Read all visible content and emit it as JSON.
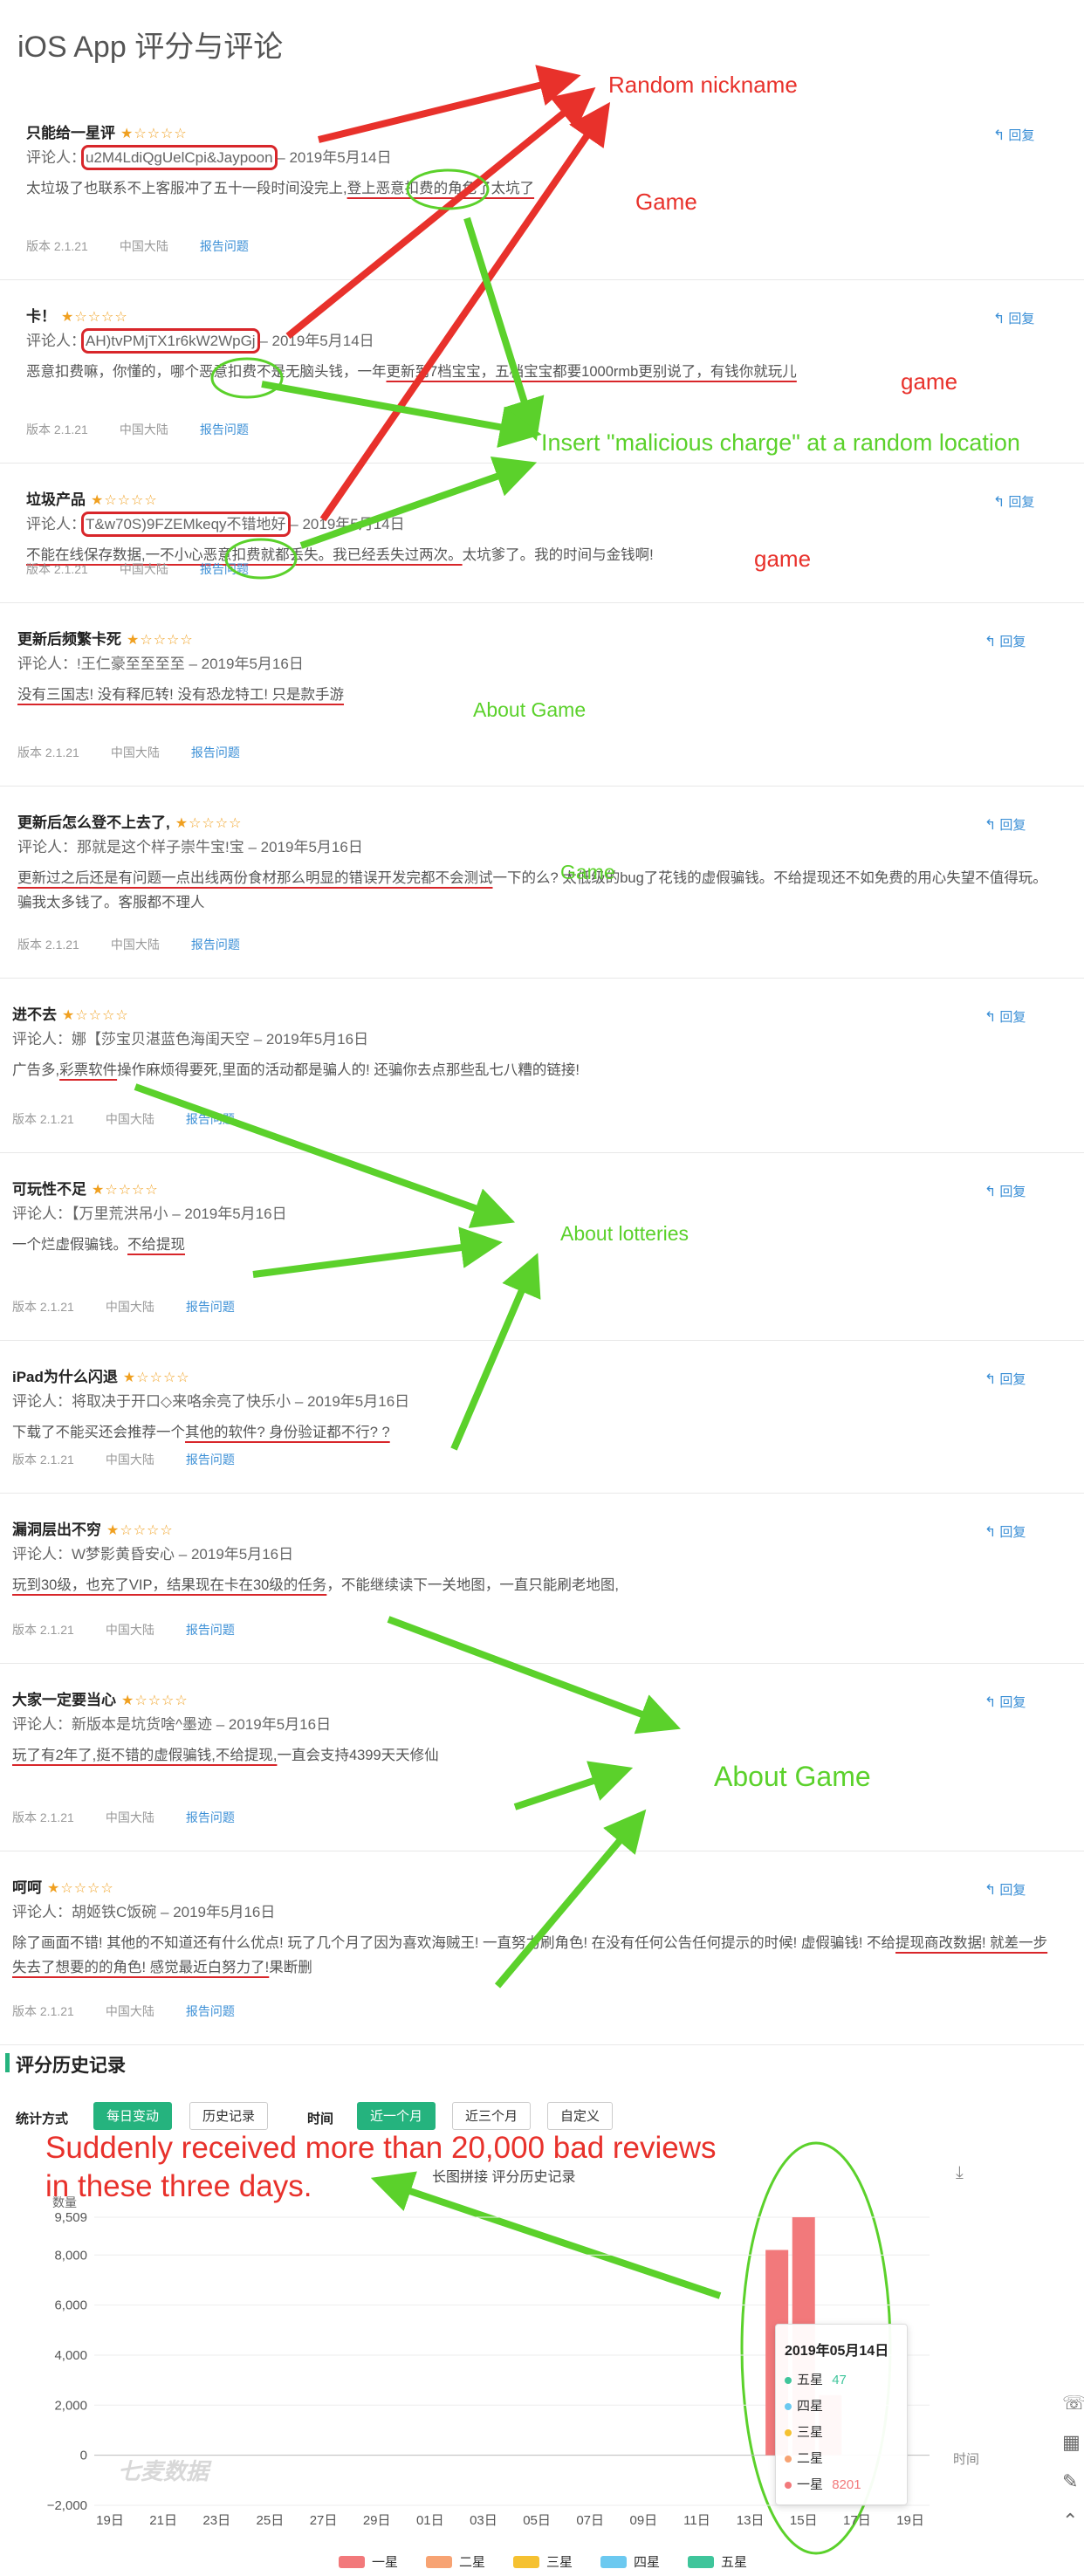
{
  "page_title": "iOS App 评分与评论",
  "reply_label": "回复",
  "report_label": "报告问题",
  "reviews": [
    {
      "title": "只能给一星评",
      "stars": "★☆☆☆☆",
      "meta_prefix": "评论人：",
      "author": "u2M4LdiQgUelCpi&Jaypoon",
      "meta_date": "– 2019年5月14日",
      "body_a": "太垃圾了也联系不上客服冲了五十一段时间没完上,",
      "body_b": "登上恶意扣费的角色了太坑了",
      "body_c": "",
      "version": "版本 2.1.21",
      "region": "中国大陆"
    },
    {
      "title": "卡！",
      "stars": "★☆☆☆☆",
      "meta_prefix": "评论人：",
      "author": "AH)tvPMjTX1r6kW2WpGj",
      "meta_date": "– 2019年5月14日",
      "body_a": "恶意扣费嘛，你懂的，哪个恶意扣费不是无脑头钱，一年",
      "body_b": "更新到7档宝宝，五档宝宝都要1000rmb更别说了，有钱你就玩儿",
      "body_c": "",
      "version": "版本 2.1.21",
      "region": "中国大陆"
    },
    {
      "title": "垃圾产品",
      "stars": "★☆☆☆☆",
      "meta_prefix": "评论人：",
      "author": "T&w70S)9FZEMkeqy不错地好",
      "meta_date": "– 2019年5月14日",
      "body_a": "",
      "body_b": "不能在线保存数据,一不小心恶意扣费就都丢失。我已经丢失过两次。",
      "body_c": "太坑爹了。我的时间与金钱啊!",
      "version": "版本 2.1.21",
      "region": "中国大陆"
    },
    {
      "title": "更新后频繁卡死",
      "stars": "★☆☆☆☆",
      "meta_prefix": "评论人：",
      "author": "!王仁豪至至至至",
      "meta_date": "– 2019年5月16日",
      "body_a": "",
      "body_b": "没有三国志! 没有释厄转! 没有恐龙特工! 只是款手游",
      "body_c": "",
      "version": "版本 2.1.21",
      "region": "中国大陆"
    },
    {
      "title": "更新后怎么登不上去了,",
      "stars": "★☆☆☆☆",
      "meta_prefix": "评论人：",
      "author": "那就是这个样子崇牛宝!宝",
      "meta_date": "– 2019年5月16日",
      "body_a": "",
      "body_b": "更新过之后还是有问题一点出线两份食材那么明显的错误开发完都不会测试",
      "body_c": "一下的么? 太低级的bug了花钱的虚假骗钱。不给提现还不如免费的用心失望不值得玩。骗我太多钱了。客服都不理人",
      "version": "版本 2.1.21",
      "region": "中国大陆"
    },
    {
      "title": "进不去",
      "stars": "★☆☆☆☆",
      "meta_prefix": "评论人：",
      "author": "娜【莎宝贝湛蓝色海闺天空",
      "meta_date": "– 2019年5月16日",
      "body_a": "广告多,",
      "body_b": "彩票软件",
      "body_c": "操作麻烦得要死,里面的活动都是骗人的! 还骗你去点那些乱七八糟的链接!",
      "version": "版本 2.1.21",
      "region": "中国大陆"
    },
    {
      "title": "可玩性不足",
      "stars": "★☆☆☆☆",
      "meta_prefix": "评论人：",
      "author": "【万里荒洪吊小",
      "meta_date": "– 2019年5月16日",
      "body_a": "一个烂虚假骗钱。",
      "body_b": "不给提现",
      "body_c": "",
      "version": "版本 2.1.21",
      "region": "中国大陆"
    },
    {
      "title": "iPad为什么闪退",
      "stars": "★☆☆☆☆",
      "meta_prefix": "评论人：",
      "author": "将取决于开口◇来咯余亮了快乐小",
      "meta_date": "– 2019年5月16日",
      "body_a": "下载了不能买还会推荐一个",
      "body_b": "其他的软件? 身份验证都不行? ?",
      "body_c": "",
      "version": "版本 2.1.21",
      "region": "中国大陆"
    },
    {
      "title": "漏洞层出不穷",
      "stars": "★☆☆☆☆",
      "meta_prefix": "评论人：",
      "author": "W梦影黄昏安心",
      "meta_date": "– 2019年5月16日",
      "body_a": "",
      "body_b": "玩到30级，也充了VIP，结果现在卡在30级的任务",
      "body_c": "，不能继续读下一关地图，一直只能刷老地图,",
      "version": "版本 2.1.21",
      "region": "中国大陆"
    },
    {
      "title": "大家一定要当心",
      "stars": "★☆☆☆☆",
      "meta_prefix": "评论人：",
      "author": "新版本是坑货啥^墨迹",
      "meta_date": "– 2019年5月16日",
      "body_a": "",
      "body_b": "玩了有2年了,挺不错的虚假骗钱,不给提现,",
      "body_c": "一直会支持4399天天修仙",
      "version": "版本 2.1.21",
      "region": "中国大陆"
    },
    {
      "title": "呵呵",
      "stars": "★☆☆☆☆",
      "meta_prefix": "评论人：",
      "author": "胡姬铁C饭碗",
      "meta_date": "– 2019年5月16日",
      "body_a": "除了画面不错! 其他的不知道还有什么优点! 玩了几个月了因为喜欢海贼王! 一直努力刷角色! 在没有任何公告任何提示的时候! 虚假骗钱! 不给",
      "body_b": "提现商改数据! 就差一步失去了想要的的角色! 感觉最近白努力了!",
      "body_c": "果断删",
      "version": "版本 2.1.21",
      "region": "中国大陆"
    }
  ],
  "annotations": {
    "random_nickname": "Random nickname",
    "game1": "Game",
    "game2": "game",
    "game3": "game",
    "insert_charge": "Insert \"malicious charge\" at a random location",
    "about_game_small": "About Game",
    "game_green": "Game",
    "about_lotteries": "About lotteries",
    "about_game_big": "About Game",
    "bad_reviews_l1": "Suddenly received more than 20,000 bad reviews",
    "bad_reviews_l2": "in these three days."
  },
  "history": {
    "section_title": "评分历史记录",
    "stat_label": "统计方式",
    "btn_daily": "每日变动",
    "btn_history": "历史记录",
    "time_label": "时间",
    "btn_1m": "近一个月",
    "btn_3m": "近三个月",
    "btn_custom": "自定义",
    "chart_subtitle": "长图拼接 评分历史记录",
    "watermark": "七麦数据",
    "x_axis_label": "时间",
    "y_axis_label": "数量"
  },
  "tooltip": {
    "date": "2019年05月14日",
    "rows": [
      {
        "label": "五星",
        "value": "47",
        "color": "#3fc59b"
      },
      {
        "label": "四星",
        "value": "",
        "color": "#6cc9f0"
      },
      {
        "label": "三星",
        "value": "",
        "color": "#f5c131"
      },
      {
        "label": "二星",
        "value": "",
        "color": "#f7a373"
      },
      {
        "label": "一星",
        "value": "8201",
        "color": "#f2797b"
      }
    ]
  },
  "chart_data": {
    "type": "bar",
    "x_ticks": [
      "19日",
      "21日",
      "23日",
      "25日",
      "27日",
      "29日",
      "01日",
      "03日",
      "05日",
      "07日",
      "09日",
      "11日",
      "13日",
      "15日",
      "17日",
      "19日"
    ],
    "y_ticks": [
      "9,509",
      "8,000",
      "6,000",
      "4,000",
      "2,000",
      "0",
      "−2,000"
    ],
    "ylim": [
      -2000,
      9509
    ],
    "series": [
      {
        "name": "一星",
        "color": "#f2797b",
        "values": [
          {
            "x": "14日",
            "y": 8201
          },
          {
            "x": "15日",
            "y": 9509
          },
          {
            "x": "16日",
            "y": 2400
          }
        ]
      },
      {
        "name": "二星",
        "color": "#f7a373",
        "values": []
      },
      {
        "name": "三星",
        "color": "#f5c131",
        "values": []
      },
      {
        "name": "四星",
        "color": "#6cc9f0",
        "values": []
      },
      {
        "name": "五星",
        "color": "#3fc59b",
        "values": [
          {
            "x": "14日",
            "y": 47
          }
        ]
      }
    ]
  }
}
